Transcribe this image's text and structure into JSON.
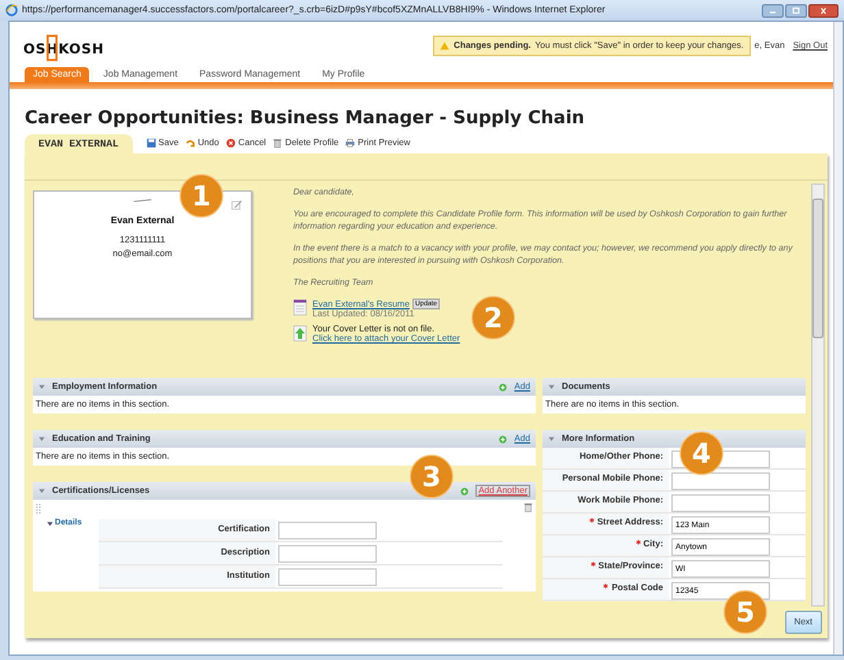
{
  "window": {
    "title": "https://performancemanager4.successfactors.com/portalcareer?_s.crb=6izD#p9sY#bcof5XZMnALLVB8HI9% - Windows Internet Explorer"
  },
  "header": {
    "logo": "OSHKOSH",
    "notice": "**Changes pending.** You must click \"Save\" in order to keep your changes.",
    "user": "e, Evan",
    "sign_out": "Sign Out"
  },
  "nav_tabs": [
    {
      "label": "Job Search",
      "selected": true
    },
    {
      "label": "Job Management",
      "selected": false
    },
    {
      "label": "Password Management",
      "selected": false
    },
    {
      "label": "My Profile",
      "selected": false
    }
  ],
  "page_title": "Career Opportunities: Business Manager - Supply Chain",
  "profile_tab": "EVAN EXTERNAL",
  "toolbar": [
    {
      "kind": "save",
      "label": "Save"
    },
    {
      "kind": "undo",
      "label": "Undo"
    },
    {
      "kind": "cancel",
      "label": "Cancel"
    },
    {
      "kind": "delete",
      "label": "Delete Profile"
    },
    {
      "kind": "print",
      "label": "Print Preview"
    }
  ],
  "card": {
    "name": "Evan External",
    "phone": "1231111111",
    "email": "no@email.com"
  },
  "letter": {
    "greeting": "Dear candidate,",
    "paragraphs": [
      "You are encouraged to complete this Candidate Profile form. This information will be used by Oshkosh Corporation to gain further information regarding your education and experience.",
      "In the event there is a match to a vacancy with your profile, we may contact you; however, we recommend you apply directly to any positions that you are interested in pursuing with Oshkosh Corporation."
    ],
    "signature": "The Recruiting Team"
  },
  "resume": {
    "link": "Evan External's Resume",
    "button": "Update",
    "updated": "Last Updated: 08/16/2011"
  },
  "cover_letter": {
    "status": "Your Cover Letter is not on file.",
    "link": "Click here to attach your Cover Letter"
  },
  "sections_left": [
    {
      "title": "Employment Information",
      "action": "Add",
      "action_highlighted": false,
      "empty": "There are no items in this section."
    },
    {
      "title": "Education and Training",
      "action": "Add",
      "action_highlighted": false,
      "empty": "There are no items in this section."
    },
    {
      "title": "Certifications/Licenses",
      "action": "Add Another",
      "action_highlighted": true,
      "details": "Details",
      "fields": [
        {
          "label": "Certification"
        },
        {
          "label": "Description"
        },
        {
          "label": "Institution"
        }
      ]
    }
  ],
  "sections_right": [
    {
      "title": "Documents",
      "empty": "There are no items in this section."
    },
    {
      "title": "More Information",
      "fields": [
        {
          "label": "Home/Other Phone:",
          "required": false
        },
        {
          "label": "Personal Mobile Phone:",
          "required": false
        },
        {
          "label": "Work Mobile Phone:",
          "required": false
        },
        {
          "label": "Street Address:",
          "required": true,
          "value": "123 Main"
        },
        {
          "label": "City:",
          "required": true,
          "value": "Anytown"
        },
        {
          "label": "State/Province:",
          "required": true,
          "value": "WI"
        },
        {
          "label": "Postal Code",
          "required": true,
          "value": "12345"
        }
      ]
    }
  ],
  "next_button": "Next",
  "callouts": [
    "1",
    "2",
    "3",
    "4",
    "5"
  ]
}
